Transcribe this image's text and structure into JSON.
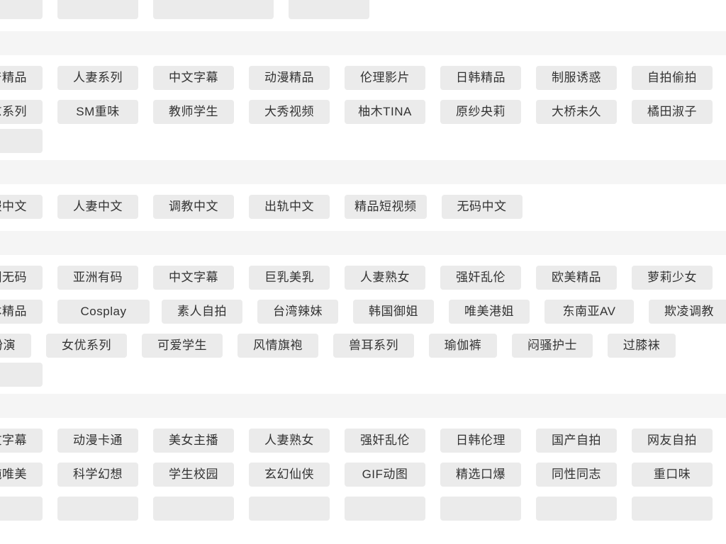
{
  "page": {
    "background_color": "#ffffff",
    "band_color": "#f5f5f5",
    "chip_color": "#ebebeb",
    "chip_text_color": "#333333"
  },
  "sections": [
    {
      "id": "section-top-clipped",
      "rows": [
        {
          "tags": [
            "",
            "",
            "",
            ""
          ]
        }
      ]
    },
    {
      "id": "section-domestic",
      "rows": [
        {
          "tags": [
            "国产精品",
            "人妻系列",
            "中文字幕",
            "动漫精品",
            "伦理影片",
            "日韩精品",
            "制服诱惑",
            "自拍偷拍"
          ]
        },
        {
          "tags": [
            "自慰系列",
            "SM重味",
            "教师学生",
            "大秀视频",
            "柚木TINA",
            "原纱央莉",
            "大桥未久",
            "橘田淑子"
          ]
        },
        {
          "tags": [
            ""
          ]
        }
      ]
    },
    {
      "id": "section-chinese-subtitle",
      "rows": [
        {
          "tags": [
            "制服中文",
            "人妻中文",
            "调教中文",
            "出轨中文",
            "精品短视频",
            "无码中文"
          ]
        }
      ]
    },
    {
      "id": "section-asian",
      "rows": [
        {
          "tags": [
            "亚洲无码",
            "亚洲有码",
            "中文字幕",
            "巨乳美乳",
            "人妻熟女",
            "强奸乱伦",
            "欧美精品",
            "萝莉少女"
          ]
        },
        {
          "tags": [
            "日本精品",
            "Cosplay",
            "素人自拍",
            "台湾辣妹",
            "韩国御姐",
            "唯美港姐",
            "东南亚AV",
            "欺凌调教"
          ]
        },
        {
          "tags": [
            "古装扮演",
            "女优系列",
            "可爱学生",
            "风情旗袍",
            "兽耳系列",
            "瑜伽裤",
            "闷骚护士",
            "过膝袜"
          ]
        },
        {
          "tags": [
            ""
          ]
        }
      ]
    },
    {
      "id": "section-anime",
      "rows": [
        {
          "tags": [
            "中文字幕",
            "动漫卡通",
            "美女主播",
            "人妻熟女",
            "强奸乱伦",
            "日韩伦理",
            "国产自拍",
            "网友自拍"
          ]
        },
        {
          "tags": [
            "清纯唯美",
            "科学幻想",
            "学生校园",
            "玄幻仙侠",
            "GIF动图",
            "精选口爆",
            "同性同志",
            "重口味"
          ]
        },
        {
          "tags": [
            "",
            "",
            "",
            "",
            "",
            "",
            "",
            ""
          ]
        }
      ]
    }
  ]
}
